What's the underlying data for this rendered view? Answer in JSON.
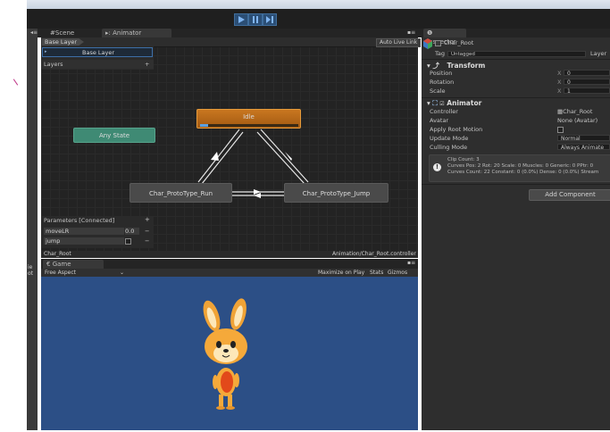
{
  "toolbar": {
    "play_label": "▶",
    "pause_label": "❚❚",
    "step_label": "▶❚"
  },
  "left_sidebar": {
    "label_line1": "ie",
    "label_line2": "ot"
  },
  "tabs": {
    "scene": "Scene",
    "animator": "Animator",
    "inspector": "Inspector",
    "game": "Game"
  },
  "animator": {
    "breadcrumb": "Base Layer",
    "auto_live_link": "Auto Live Link",
    "layer_name": "Base Layer",
    "layers_label": "Layers",
    "add_symbol": "+",
    "states": {
      "idle": "Idle",
      "any_state": "Any State",
      "run": "Char_ProtoType_Run",
      "jump": "Char_ProtoType_Jump"
    },
    "parameters_title": "Parameters [Connected]",
    "parameters": [
      {
        "name": "moveLR",
        "value": "0.0",
        "remove": "−"
      },
      {
        "name": "jump",
        "value": "",
        "remove": "−"
      }
    ],
    "footer_left": "Char_Root",
    "footer_right": "Animation/Char_Root.controller"
  },
  "game": {
    "aspect": "Free Aspect",
    "maximize": "Maximize on Play",
    "stats": "Stats",
    "gizmos": "Gizmos",
    "game_bg": "#2c4f86"
  },
  "inspector": {
    "object_name": "Char_Root",
    "tag_label": "Tag",
    "tag_value": "Untagged",
    "layer_label": "Layer",
    "transform": {
      "title": "Transform",
      "position": "Position",
      "rotation": "Rotation",
      "scale": "Scale",
      "x_label": "X",
      "pos_x": "0",
      "rot_x": "0",
      "scale_x": "1"
    },
    "animator_component": {
      "title": "Animator",
      "controller_label": "Controller",
      "controller_value": "Char_Root",
      "avatar_label": "Avatar",
      "avatar_value": "None (Avatar)",
      "root_motion_label": "Apply Root Motion",
      "update_mode_label": "Update Mode",
      "update_mode_value": "Normal",
      "culling_label": "Culling Mode",
      "culling_value": "Always Animate",
      "info_line1": "Clip Count: 3",
      "info_line2": "Curves Pos: 2 Rot: 20 Scale: 0 Muscles: 0 Generic: 0 PPtr: 0",
      "info_line3": "Curves Count: 22 Constant: 0 (0.0%) Dense: 0 (0.0%) Stream"
    },
    "add_component": "Add Component"
  },
  "colors": {
    "accent": "#3d6fa8",
    "idle_state": "#c4731c",
    "any_state": "#3f8a74"
  }
}
